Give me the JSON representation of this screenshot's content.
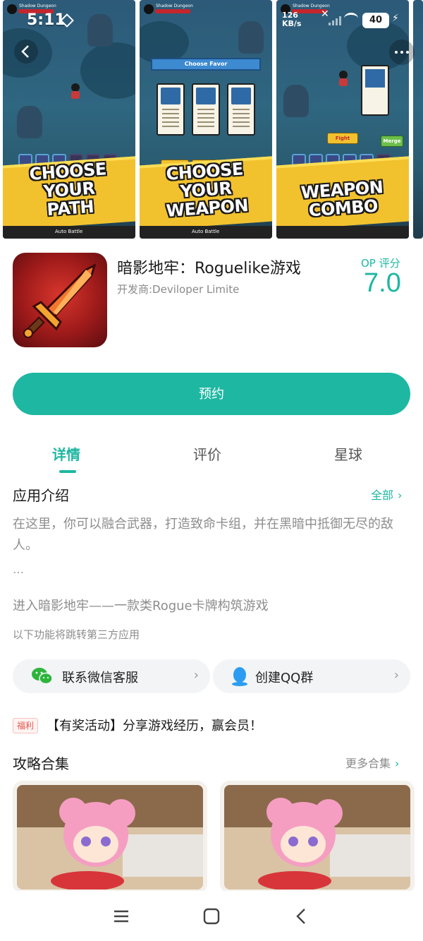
{
  "status_bar": {
    "time": "5:11",
    "network_speed": "126\nKB/s",
    "battery": "40"
  },
  "carousel": {
    "screens": [
      {
        "hud_name": "Shadow Dungeon",
        "hp": "686",
        "banner": "CHOOSE YOUR\nPATH",
        "bottom_label": "Auto Battle"
      },
      {
        "hud_name": "Shadow Dungeon",
        "hp": "681",
        "title": "Choose Favor",
        "banner": "CHOOSE YOUR\nWEAPON",
        "bottom_label": "Auto Battle"
      },
      {
        "hud_name": "Shadow Dungeon",
        "hp": "644",
        "fight": "Fight",
        "merge": "Merge",
        "banner": "WEAPON\nCOMBO"
      }
    ]
  },
  "top_actions": {
    "back_icon": "back-icon",
    "more_icon": "more-icon"
  },
  "app": {
    "name": "暗影地牢：Roguelike游戏",
    "developer": "开发商:Deviloper Limite",
    "rating_label": "OP 评分",
    "rating": "7.0"
  },
  "reserve_button": "预约",
  "tabs": [
    {
      "label": "详情",
      "active": true
    },
    {
      "label": "评价",
      "active": false
    },
    {
      "label": "星球",
      "active": false
    }
  ],
  "intro": {
    "title": "应用介绍",
    "all_link": "全部",
    "text": "在这里，你可以融合武器，打造致命卡组，并在黑暗中抵御无尽的敌人。",
    "ellipsis": "…",
    "tagline": "进入暗影地牢——一款类Rogue卡牌构筑游戏",
    "third_party_note": "以下功能将跳转第三方应用"
  },
  "contact": {
    "wechat": "联系微信客服",
    "qq": "创建QQ群"
  },
  "activity": {
    "badge": "福利",
    "text": "【有奖活动】分享游戏经历，赢会员！"
  },
  "guides": {
    "title": "攻略合集",
    "more_link": "更多合集"
  },
  "colors": {
    "accent": "#1eb7a2",
    "banner_yellow": "#f2c12e"
  }
}
